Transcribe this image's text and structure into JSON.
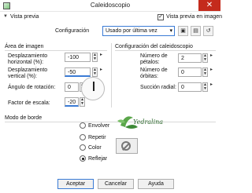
{
  "window": {
    "title": "Caleidoscopio",
    "close_glyph": "✕"
  },
  "preview": {
    "label": "Vista previa",
    "image_preview_label": "Vista previa en imagen",
    "image_preview_checked": true
  },
  "config": {
    "label": "Configuración",
    "value": "Usado por última vez"
  },
  "image_area": {
    "title": "Área de imagen",
    "fields": [
      {
        "label_line1": "Desplazamiento",
        "label_line2": "horizontal (%):",
        "value": "-100"
      },
      {
        "label_line1": "Desplazamiento",
        "label_line2": "vertical (%):",
        "value": "-50"
      },
      {
        "label_line1": "Ángulo de rotación:",
        "label_line2": "",
        "value": "0"
      },
      {
        "label_line1": "Factor de escala:",
        "label_line2": "",
        "value": "-20"
      }
    ]
  },
  "kaleido": {
    "title": "Configuración del caleidoscopio",
    "fields": [
      {
        "label_line1": "Número de",
        "label_line2": "pétalos:",
        "value": "2"
      },
      {
        "label_line1": "Número de",
        "label_line2": "órbitas:",
        "value": "0"
      },
      {
        "label_line1": "Succión radial:",
        "label_line2": "",
        "value": "0"
      }
    ]
  },
  "edge_mode": {
    "title": "Modo de borde",
    "options": [
      "Envolver",
      "Repetir",
      "Color",
      "Reflejar"
    ],
    "selected": "Reflejar"
  },
  "watermark_text": "Yedralina",
  "buttons": {
    "ok": "Aceptar",
    "cancel": "Cancelar",
    "help": "Ayuda"
  },
  "colors": {
    "accent": "#3a7bd5",
    "close": "#c42b1c",
    "watermark": "#2f6a2f"
  }
}
